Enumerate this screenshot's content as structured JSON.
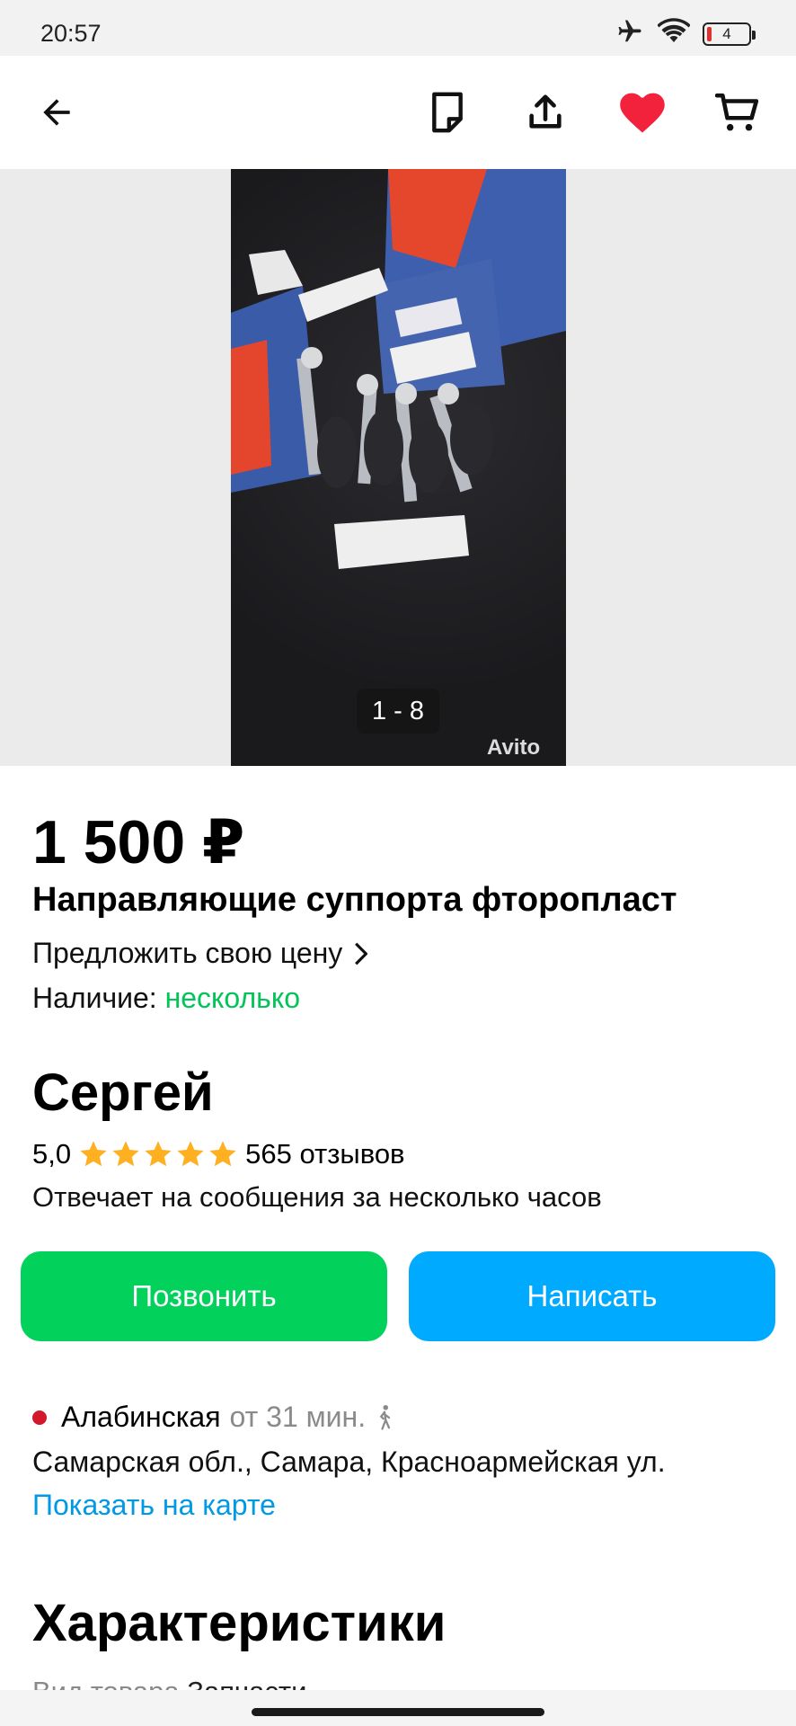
{
  "status_bar": {
    "time": "20:57",
    "battery_level": "4"
  },
  "toolbar": {
    "icons": [
      "back-arrow-icon",
      "note-icon",
      "share-icon",
      "heart-icon",
      "cart-icon"
    ],
    "heart_color": "#f2223c"
  },
  "gallery": {
    "counter": "1 - 8",
    "watermark": "Avito"
  },
  "listing": {
    "price": "1 500 ₽",
    "title": "Направляющие суппорта фторопласт",
    "offer_price": "Предложить свою цену",
    "availability_label": "Наличие:",
    "availability_value": "несколько"
  },
  "seller": {
    "name": "Сергей",
    "rating": "5,0",
    "rating_stars": 5,
    "reviews": "565 отзывов",
    "response_time": "Отвечает на сообщения за несколько часов"
  },
  "actions": {
    "call_label": "Позвонить",
    "write_label": "Написать"
  },
  "location": {
    "metro": "Алабинская",
    "metro_time": "от 31 мин.",
    "address": "Самарская обл., Самара, Красноармейская ул.",
    "map_link": "Показать на карте"
  },
  "specs": {
    "title": "Характеристики",
    "first_label": "Вид товара",
    "first_value": "Запчасти"
  },
  "colors": {
    "green": "#02d15c",
    "blue": "#00aaff",
    "availability_green": "#02c45a",
    "star": "#ffb021",
    "metro_red": "#d3182c"
  }
}
